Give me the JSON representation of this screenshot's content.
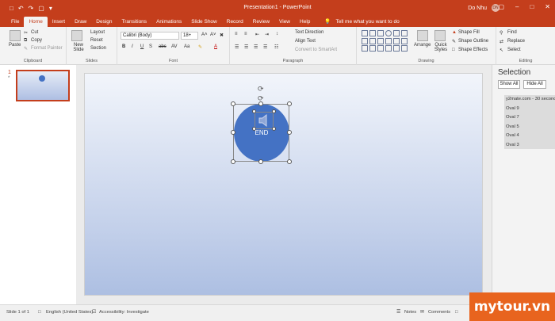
{
  "titlebar": {
    "title": "Presentation1 - PowerPoint",
    "user_name": "Do Nhu",
    "user_initials": "DN",
    "qat_icons": [
      "save-icon",
      "undo-icon",
      "redo-icon",
      "start-from-beginning-icon",
      "customize-qat-icon"
    ]
  },
  "tabs": [
    "File",
    "Home",
    "Insert",
    "Draw",
    "Design",
    "Transitions",
    "Animations",
    "Slide Show",
    "Record",
    "Review",
    "View",
    "Help"
  ],
  "active_tab": "Home",
  "tell_me": "Tell me what you want to do",
  "ribbon": {
    "clipboard": {
      "paste": "Paste",
      "cut": "Cut",
      "copy": "Copy",
      "format_painter": "Format Painter",
      "label": "Clipboard"
    },
    "slides": {
      "new_slide": "New Slide",
      "layout": "Layout",
      "reset": "Reset",
      "section": "Section",
      "label": "Slides"
    },
    "font": {
      "font_name": "Calibri (Body)",
      "font_size": "18+",
      "label": "Font"
    },
    "paragraph": {
      "text_direction": "Text Direction",
      "align_text": "Align Text",
      "smartart": "Convert to SmartArt",
      "label": "Paragraph"
    },
    "drawing": {
      "arrange": "Arrange",
      "quick_styles": "Quick Styles",
      "shape_fill": "Shape Fill",
      "shape_outline": "Shape Outline",
      "shape_effects": "Shape Effects",
      "label": "Drawing"
    },
    "editing": {
      "find": "Find",
      "replace": "Replace",
      "select": "Select",
      "label": "Editing"
    }
  },
  "slide_panel": {
    "slide_number": "1",
    "star": "*"
  },
  "slide": {
    "shape_text": "END",
    "shape_color": "#4472c4"
  },
  "selection_pane": {
    "title": "Selection",
    "show_all": "Show All",
    "hide_all": "Hide All",
    "items": [
      "y2mate.com - 30 seconds",
      "Oval 9",
      "Oval 7",
      "Oval 5",
      "Oval 4",
      "Oval 3"
    ]
  },
  "status": {
    "slide_info": "Slide 1 of 1",
    "language": "English (United States)",
    "accessibility": "Accessibility: Investigate",
    "notes": "Notes",
    "comments": "Comments"
  },
  "watermark": "mytour.vn",
  "colors": {
    "accent": "#c43e1c",
    "oval": "#4472c4",
    "watermark": "#e8641e"
  }
}
